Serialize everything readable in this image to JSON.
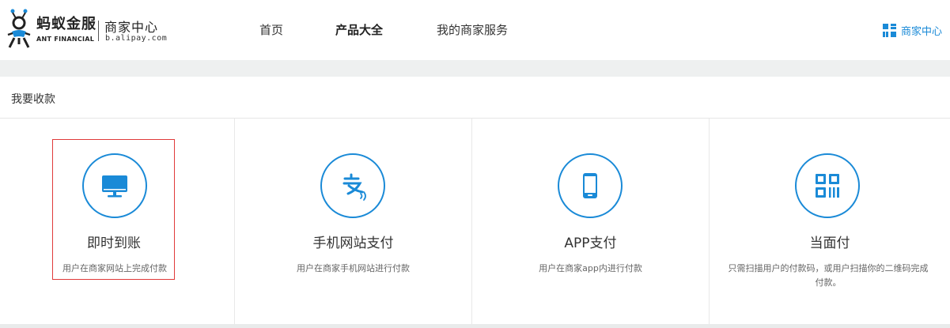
{
  "header": {
    "brand_cn": "蚂蚁金服",
    "brand_en": "ANT FINANCIAL",
    "center_cn": "商家中心",
    "domain": "b.alipay.com",
    "nav": [
      {
        "label": "首页",
        "active": false
      },
      {
        "label": "产品大全",
        "active": true
      },
      {
        "label": "我的商家服务",
        "active": false
      }
    ],
    "merchant_center": "商家中心",
    "accent": "#1a8ad7"
  },
  "panel": {
    "title": "我要收款",
    "cards": [
      {
        "icon": "monitor-icon",
        "title": "即时到账",
        "desc": "用户在商家网站上完成付款",
        "highlighted": true
      },
      {
        "icon": "alipay-mobile-icon",
        "title": "手机网站支付",
        "desc": "用户在商家手机网站进行付款",
        "highlighted": false
      },
      {
        "icon": "smartphone-icon",
        "title": "APP支付",
        "desc": "用户在商家app内进行付款",
        "highlighted": false
      },
      {
        "icon": "qrcode-scan-icon",
        "title": "当面付",
        "desc": "只需扫描用户的付款码，或用户扫描你的二维码完成付款。",
        "highlighted": false
      }
    ]
  }
}
